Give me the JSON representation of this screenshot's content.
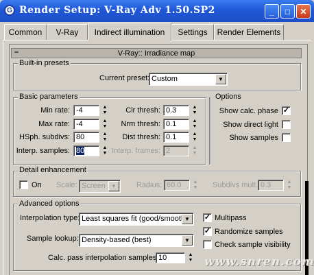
{
  "window": {
    "title": "Render Setup: V-Ray Adv 1.50.SP2",
    "app_icon_glyph": "G",
    "controls": {
      "minimize": "_",
      "maximize": "□",
      "close": "✕"
    }
  },
  "tabs": [
    "Common",
    "V-Ray",
    "Indirect illumination",
    "Settings",
    "Render Elements"
  ],
  "active_tab": "Indirect illumination",
  "rollout": {
    "collapse": "–",
    "title": "V-Ray:: Irradiance map"
  },
  "builtin_presets": {
    "label": "Built-in presets",
    "current_preset_label": "Current preset:",
    "current_preset_value": "Custom"
  },
  "basic_parameters": {
    "label": "Basic parameters",
    "min_rate": {
      "label": "Min rate:",
      "value": "-4"
    },
    "max_rate": {
      "label": "Max rate:",
      "value": "-4"
    },
    "hsph_subdivs": {
      "label": "HSph. subdivs:",
      "value": "80"
    },
    "interp_samples": {
      "label": "Interp. samples:",
      "value": "80"
    },
    "clr_thresh": {
      "label": "Clr thresh:",
      "value": "0.3"
    },
    "nrm_thresh": {
      "label": "Nrm thresh:",
      "value": "0.1"
    },
    "dist_thresh": {
      "label": "Dist thresh:",
      "value": "0.1"
    },
    "interp_frames": {
      "label": "Interp. frames:",
      "value": "2"
    }
  },
  "options": {
    "label": "Options",
    "show_calc_phase": {
      "label": "Show calc. phase",
      "checked": true
    },
    "show_direct_light": {
      "label": "Show direct light",
      "checked": false
    },
    "show_samples": {
      "label": "Show samples",
      "checked": false
    }
  },
  "detail_enhancement": {
    "label": "Detail enhancement",
    "on": {
      "label": "On",
      "checked": false
    },
    "scale_label": "Scale:",
    "scale_value": "Screen",
    "radius_label": "Radius:",
    "radius_value": "60.0",
    "subdivs_mult_label": "Subdivs mult.",
    "subdivs_mult_value": "0.3"
  },
  "advanced_options": {
    "label": "Advanced options",
    "interpolation_type_label": "Interpolation type:",
    "interpolation_type_value": "Least squares fit (good/smooth",
    "sample_lookup_label": "Sample lookup:",
    "sample_lookup_value": "Density-based (best)",
    "calc_pass_label": "Calc. pass interpolation samples:",
    "calc_pass_value": "10",
    "multipass": {
      "label": "Multipass",
      "checked": true
    },
    "randomize_samples": {
      "label": "Randomize samples",
      "checked": true
    },
    "check_sample_visibility": {
      "label": "Check sample visibility",
      "checked": false
    }
  },
  "watermark": "www.snren.com",
  "icons": {
    "check": "✓",
    "spin_up": "▲",
    "spin_down": "▼",
    "dropdown": "▼"
  },
  "colors": {
    "titlebar": "#2058d8",
    "face": "#d4d0c8",
    "selection": "#0a246a"
  }
}
